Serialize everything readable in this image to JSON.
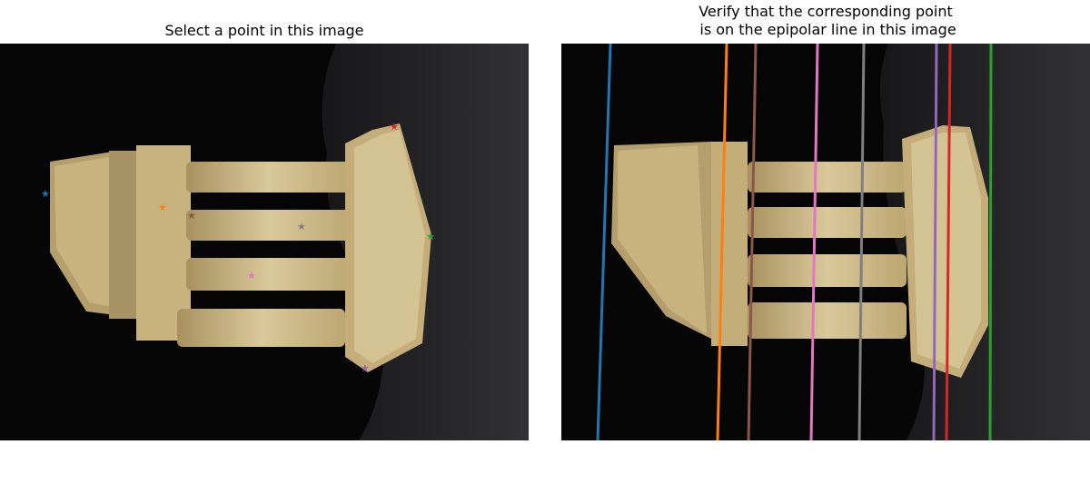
{
  "left_panel": {
    "title": "Select a point in this image",
    "markers": [
      {
        "color": "#1f77b4"
      },
      {
        "color": "#ff7f0e"
      },
      {
        "color": "#2ca02c"
      },
      {
        "color": "#d62728"
      },
      {
        "color": "#9467bd"
      },
      {
        "color": "#8c564b"
      },
      {
        "color": "#e377c2"
      },
      {
        "color": "#7f7f7f"
      }
    ]
  },
  "right_panel": {
    "title": "Verify that the corresponding point\n is on the epipolar line in this image",
    "lines": [
      {
        "color": "#1f77b4"
      },
      {
        "color": "#ff7f0e"
      },
      {
        "color": "#8c564b"
      },
      {
        "color": "#e377c2"
      },
      {
        "color": "#7f7f7f"
      },
      {
        "color": "#9467bd"
      },
      {
        "color": "#d62728"
      },
      {
        "color": "#2ca02c"
      }
    ]
  }
}
